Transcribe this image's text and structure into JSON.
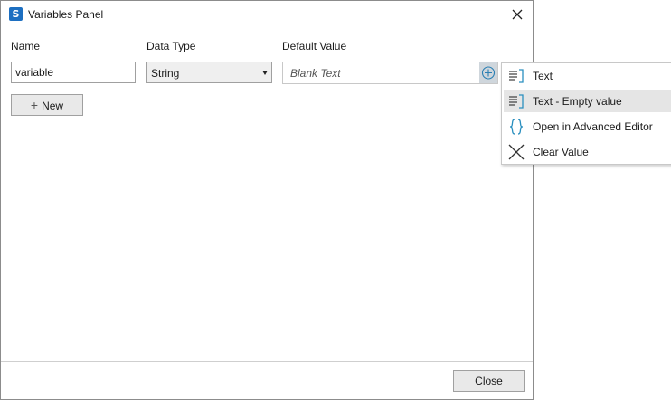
{
  "window": {
    "title": "Variables Panel",
    "icon": "app-logo-icon",
    "close_icon": "close-icon"
  },
  "form": {
    "name_label": "Name",
    "type_label": "Data Type",
    "default_label": "Default Value",
    "name_value": "variable",
    "type_value": "String",
    "default_placeholder": "Blank Text",
    "new_label": "New"
  },
  "menu": {
    "items": [
      {
        "label": "Text",
        "icon": "text-lines-icon"
      },
      {
        "label": "Text - Empty value",
        "icon": "text-lines-icon",
        "highlighted": true
      },
      {
        "label": "Open in Advanced Editor",
        "icon": "braces-icon"
      },
      {
        "label": "Clear Value",
        "icon": "close-icon"
      }
    ]
  },
  "footer": {
    "close_label": "Close"
  },
  "colors": {
    "accent": "#1d6fc1",
    "icon_teal": "#2a8fbf",
    "menu_highlight": "#e5e5e5"
  }
}
